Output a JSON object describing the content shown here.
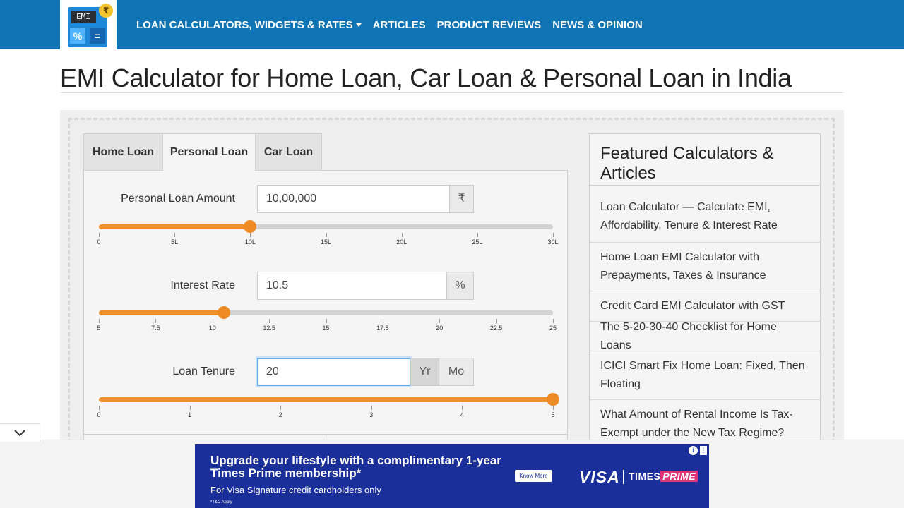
{
  "logo": {
    "screen_text": "EMI",
    "coin_symbol": "₹",
    "key_percent": "%",
    "key_equals": "="
  },
  "nav": {
    "items": [
      {
        "label": "LOAN CALCULATORS, WIDGETS & RATES",
        "dropdown": true
      },
      {
        "label": "ARTICLES"
      },
      {
        "label": "PRODUCT REVIEWS"
      },
      {
        "label": "NEWS & OPINION"
      }
    ]
  },
  "page_title": "EMI Calculator for Home Loan, Car Loan & Personal Loan in India",
  "tabs": [
    {
      "label": "Home Loan",
      "active": false
    },
    {
      "label": "Personal Loan",
      "active": true
    },
    {
      "label": "Car Loan",
      "active": false
    }
  ],
  "fields": {
    "amount": {
      "label": "Personal Loan Amount",
      "value": "10,00,000",
      "unit": "₹",
      "slider": {
        "min": 0,
        "max": 30,
        "value": 10,
        "ticks": [
          "0",
          "5L",
          "10L",
          "15L",
          "20L",
          "25L",
          "30L"
        ]
      }
    },
    "rate": {
      "label": "Interest Rate",
      "value": "10.5",
      "unit": "%",
      "slider": {
        "min": 5,
        "max": 25,
        "value": 10.5,
        "ticks": [
          "5",
          "7.5",
          "10",
          "12.5",
          "15",
          "17.5",
          "20",
          "22.5",
          "25"
        ]
      }
    },
    "tenure": {
      "label": "Loan Tenure",
      "value": "20",
      "unit_year": "Yr",
      "unit_month": "Mo",
      "selected_unit": "Yr",
      "slider": {
        "min": 0,
        "max": 5,
        "value": 5,
        "ticks": [
          "0",
          "1",
          "2",
          "3",
          "4",
          "5"
        ]
      }
    }
  },
  "sidebar": {
    "title": "Featured Calculators & Articles",
    "items": [
      "Loan Calculator — Calculate EMI, Affordability, Tenure & Interest Rate",
      "Home Loan EMI Calculator with Prepayments, Taxes & Insurance",
      "Credit Card EMI Calculator with GST",
      "The 5-20-30-40 Checklist for Home Loans",
      "ICICI Smart Fix Home Loan: Fixed, Then Floating",
      "What Amount of Rental Income Is Tax-Exempt under the New Tax Regime?"
    ]
  },
  "ad": {
    "headline": "Upgrade your lifestyle with a complimentary 1-year Times Prime membership*",
    "subline": "For Visa Signature credit cardholders only",
    "fine_print": "*T&C Apply",
    "button": "Know More",
    "brand1": "VISA",
    "brand2_a": "TIMES",
    "brand2_b": "PRIME",
    "info_glyph": "i",
    "close_glyph": "⋮"
  },
  "colors": {
    "nav_bg": "#0e74b4",
    "slider_fill": "#f0902b",
    "ad_bg": "#1b2f9a"
  }
}
